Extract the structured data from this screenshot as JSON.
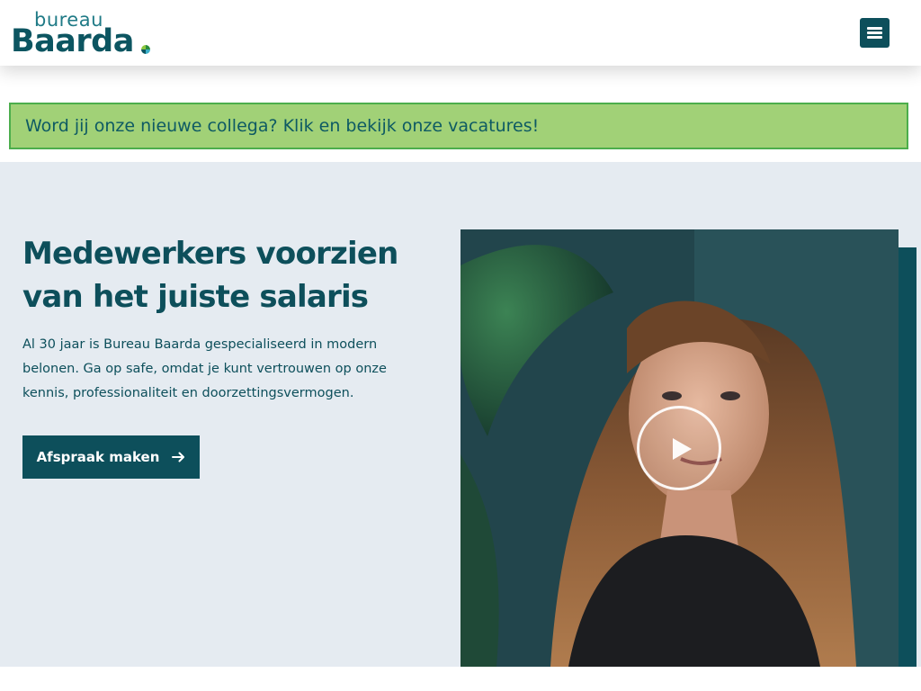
{
  "header": {
    "logo_small": "bureau",
    "logo_big": "Baarda",
    "menu_icon": "hamburger-menu-icon"
  },
  "banner": {
    "text": "Word jij onze nieuwe collega? Klik en bekijk onze vacatures!"
  },
  "hero": {
    "title": "Medewerkers voorzien van het juiste salaris",
    "text": "Al 30 jaar is Bureau Baarda gespecialiseerd in modern belonen. Ga op safe, omdat je kunt vertrouwen op onze kennis, professionaliteit en doorzettingsvermogen.",
    "cta_label": "Afspraak maken",
    "cta_icon": "arrow-right-icon",
    "video_icon": "play-icon"
  },
  "colors": {
    "primary": "#0d4f5b",
    "banner_bg": "#a1d177",
    "banner_border": "#4cae4c",
    "hero_bg": "#e5ebf1"
  }
}
